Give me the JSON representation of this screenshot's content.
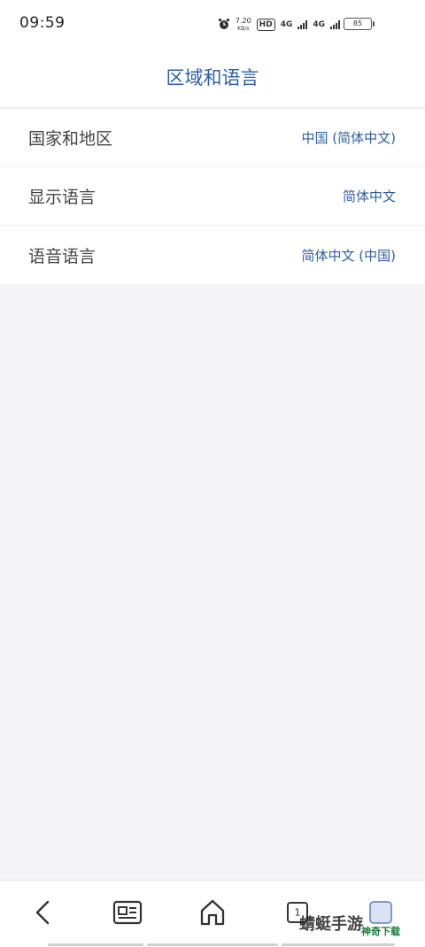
{
  "status_bar": {
    "time": "09:59",
    "speed_value": "7.20",
    "speed_unit": "KB/s",
    "hd_label": "HD",
    "network_1": "4G",
    "network_2": "4G",
    "battery": "85"
  },
  "header": {
    "title": "区域和语言"
  },
  "settings": {
    "rows": [
      {
        "label": "国家和地区",
        "value": "中国 (简体中文)"
      },
      {
        "label": "显示语言",
        "value": "简体中文"
      },
      {
        "label": "语音语言",
        "value": "简体中文 (中国)"
      }
    ]
  },
  "bottom_nav": {
    "tab_count": "1"
  },
  "watermark": {
    "text": "蜻蜓手游",
    "sub": "神奇下载"
  },
  "colors": {
    "accent": "#2f5f9f",
    "background": "#f5f5f7"
  }
}
